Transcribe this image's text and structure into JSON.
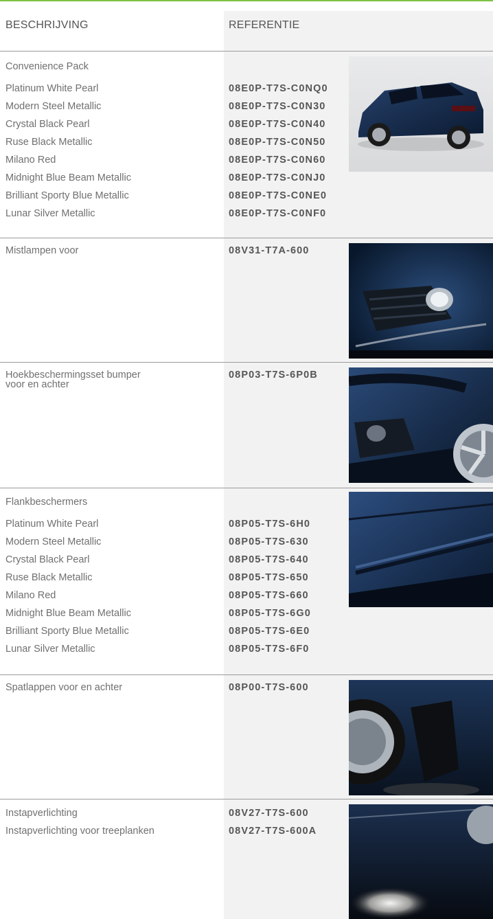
{
  "columns": {
    "description": "BESCHRIJVING",
    "reference": "REFERENTIE"
  },
  "sections": [
    {
      "title": "Convenience Pack",
      "rows": [
        {
          "desc": "Platinum White Pearl",
          "ref": "08E0P-T7S-C0NQ0"
        },
        {
          "desc": "Modern Steel Metallic",
          "ref": "08E0P-T7S-C0N30"
        },
        {
          "desc": "Crystal Black Pearl",
          "ref": "08E0P-T7S-C0N40"
        },
        {
          "desc": "Ruse Black Metallic",
          "ref": "08E0P-T7S-C0N50"
        },
        {
          "desc": "Milano Red",
          "ref": "08E0P-T7S-C0N60"
        },
        {
          "desc": "Midnight Blue Beam Metallic",
          "ref": "08E0P-T7S-C0NJ0"
        },
        {
          "desc": "Brilliant Sporty Blue Metallic",
          "ref": "08E0P-T7S-C0NE0"
        },
        {
          "desc": "Lunar Silver Metallic",
          "ref": "08E0P-T7S-C0NF0"
        }
      ]
    },
    {
      "rows": [
        {
          "desc": "Mistlampen voor",
          "ref": "08V31-T7A-600"
        }
      ]
    },
    {
      "rows": [
        {
          "desc": "Hoekbeschermingsset bumper\nvoor en achter",
          "ref": "08P03-T7S-6P0B"
        }
      ]
    },
    {
      "title": "Flankbeschermers",
      "rows": [
        {
          "desc": "Platinum White Pearl",
          "ref": "08P05-T7S-6H0"
        },
        {
          "desc": "Modern Steel Metallic",
          "ref": "08P05-T7S-630"
        },
        {
          "desc": "Crystal Black Pearl",
          "ref": "08P05-T7S-640"
        },
        {
          "desc": "Ruse Black Metallic",
          "ref": "08P05-T7S-650"
        },
        {
          "desc": "Milano Red",
          "ref": "08P05-T7S-660"
        },
        {
          "desc": "Midnight Blue Beam Metallic",
          "ref": "08P05-T7S-6G0"
        },
        {
          "desc": "Brilliant Sporty Blue Metallic",
          "ref": "08P05-T7S-6E0"
        },
        {
          "desc": "Lunar Silver Metallic",
          "ref": "08P05-T7S-6F0"
        }
      ]
    },
    {
      "rows": [
        {
          "desc": "Spatlappen voor en achter",
          "ref": "08P00-T7S-600"
        }
      ]
    },
    {
      "rows": [
        {
          "desc": "Instapverlichting",
          "ref": "08V27-T7S-600"
        },
        {
          "desc": "Instapverlichting voor treeplanken",
          "ref": "08V27-T7S-600A"
        }
      ]
    }
  ],
  "colors": {
    "accent_rule": "#7dc242",
    "reference_column_bg": "#f2f2f2",
    "separator": "#9a9a9a",
    "car_body": "#0f2340"
  }
}
